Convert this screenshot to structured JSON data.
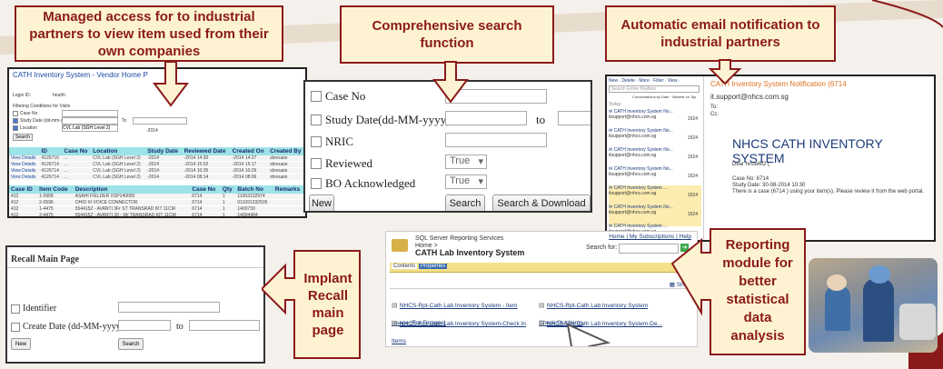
{
  "callouts": {
    "vendor": "Managed access for to industrial partners to view item used from their own companies",
    "search": "Comprehensive search function",
    "email": "Automatic email notification to industrial partners",
    "recall": "Implant Recall main page",
    "reporting": "Reporting module for better statistical data analysis"
  },
  "vendor_home": {
    "title": "CATH Inventory System - Vendor Home P",
    "login_label": "Login ID:",
    "login_value": "hnuhh",
    "filter_label": "Filtering Conditions for Visits",
    "case_label": "Case No",
    "study_label": "Study Date (dd-mm-yyyy)",
    "study_from": "-2014",
    "to_label": "To",
    "study_to": "-2014",
    "location_label": "Location",
    "location_value": "CVL Lab (SGH Level 2)",
    "search_button": "Search",
    "grid1_headers": [
      "",
      "ID",
      "Case No",
      "Location",
      "Study Date",
      "Reviewed Date",
      "Created On",
      "Created By"
    ],
    "grid1_rows": [
      [
        "View Details",
        "4126716",
        "...",
        "CVL Lab (SGH Level 2)",
        "-2014",
        "-2014 14:30",
        "-2014 14:37",
        "sbreuaie"
      ],
      [
        "View Details",
        "4126714",
        "...",
        "CVL Lab (SGH Level 2)",
        "-2014",
        "-2014 15:02",
        "-2014 15:17",
        "sbreuaie"
      ],
      [
        "View Details",
        "4126714",
        "...",
        "CVL Lab (SGH Level 2)",
        "-2014",
        "-2014 10:35",
        "-2014 10:29",
        "sbreuaie"
      ],
      [
        "View Details",
        "4126714",
        "...",
        "CVL Lab (SGH Level 2)",
        "-2014",
        "-2014 08:14",
        "-2014 08:06",
        "sbreuaie"
      ]
    ],
    "grid2_headers": [
      "Case ID",
      "Item Code",
      "Description",
      "Case No",
      "Qty",
      "Batch No",
      "Remarks"
    ],
    "grid2_rows": [
      [
        "412",
        "1-0958",
        "ASAHI FIELDER XSP140000",
        "6714",
        "1",
        "11063132974",
        ""
      ],
      [
        "412",
        "2-0596",
        "OHIO III VOICE CONNECTOR",
        "6714",
        "1",
        "011091332505",
        ""
      ],
      [
        "412",
        "1-4475",
        "554415Z - AVANTI 3Fr ST TRANSRAD KIT 11CM",
        "6714",
        "1",
        "1400730",
        ""
      ],
      [
        "412",
        "2-4475",
        "554415Z - AVANTI 30 - W/ TRANSRAD KIT 11CM",
        "6714",
        "1",
        "14004484",
        ""
      ]
    ]
  },
  "search_panel": {
    "case_label": "Case No",
    "study_label": "Study Date(dd-MM-yyyy)",
    "to_label": "to",
    "nric_label": "NRIC",
    "reviewed_label": "Reviewed",
    "reviewed_value": "True",
    "bo_label": "BO Acknowledged",
    "bo_value": "True",
    "new_button": "New",
    "search_button": "Search",
    "search_download_button": "Search & Download"
  },
  "email": {
    "toolbar": "New · Delete · More · Filter · View ·",
    "search_placeholder": "Search Entire Mailbox",
    "sort_label": "Conversations by Date · Newest on Top",
    "today_label": "Today",
    "items": [
      {
        "subject": "CATH Inventory System No...",
        "from": "itsupport@nhcs.com.sg",
        "time": "1524"
      },
      {
        "subject": "CATH Inventory System No...",
        "from": "itsupport@nhcs.com.sg",
        "time": "1524"
      },
      {
        "subject": "CATH Inventory System No...",
        "from": "itsupport@nhcs.com.sg",
        "time": "1524"
      },
      {
        "subject": "CATH Inventory System No...",
        "from": "itsupport@nhcs.com.sg",
        "time": "1524"
      },
      {
        "subject": "CATH Inventory System ...",
        "from": "itsupport@nhcs.com.sg",
        "time": "1524"
      },
      {
        "subject": "CATH Inventory System No...",
        "from": "itsupport@nhcs.com.sg",
        "time": "1524"
      },
      {
        "subject": "CATH Inventory System ...",
        "from": "itsupport@nhcs.com.sg",
        "time": "1524"
      }
    ],
    "reading_subject": "CATH Inventory System Notification (6714",
    "reading_sender": "it.support@nhcs.com.sg",
    "to_label": "To:",
    "cc_label": "Cc:",
    "heading": "NHCS CATH INVENTORY SYSTEM",
    "greeting": "Dear hnuw6f2 (",
    "case_line": "Case No: 6714",
    "date_line": "Study Date: 30-08-2014 10:30",
    "body": "There is a case (6714        ) using your item(s). Please review it from the web portal."
  },
  "recall": {
    "title": "Recall Main Page",
    "identifier_label": "Identifier",
    "create_date_label": "Create Date (dd-MM-yyyy)",
    "to_label": "to",
    "new_button": "New",
    "search_button": "Search"
  },
  "ssrs": {
    "product": "SQL Server Reporting Services",
    "breadcrumb": "Home >",
    "folder": "CATH Lab Inventory System",
    "top_links": "Home | My Subscriptions | Help",
    "search_label": "Search for:",
    "tab_contents": "Contents",
    "tab_properties": "Properties",
    "show_details": "Show",
    "reports": [
      "NHCS-Rpt-Cath Lab Inventory System - Item Usage (For Finance)",
      "NHCS-Rpt-Cath Lab Inventory System-Check In Items",
      "NHCS-Rpt-Cath Lab Inventory System Check Out Items",
      "NHCS-Rpt-Cath Lab Inventory System-De..."
    ]
  },
  "colors": {
    "callout_border": "#8b1a1a",
    "callout_fill": "#fdf3d2",
    "grid_header": "#9de3e8"
  }
}
